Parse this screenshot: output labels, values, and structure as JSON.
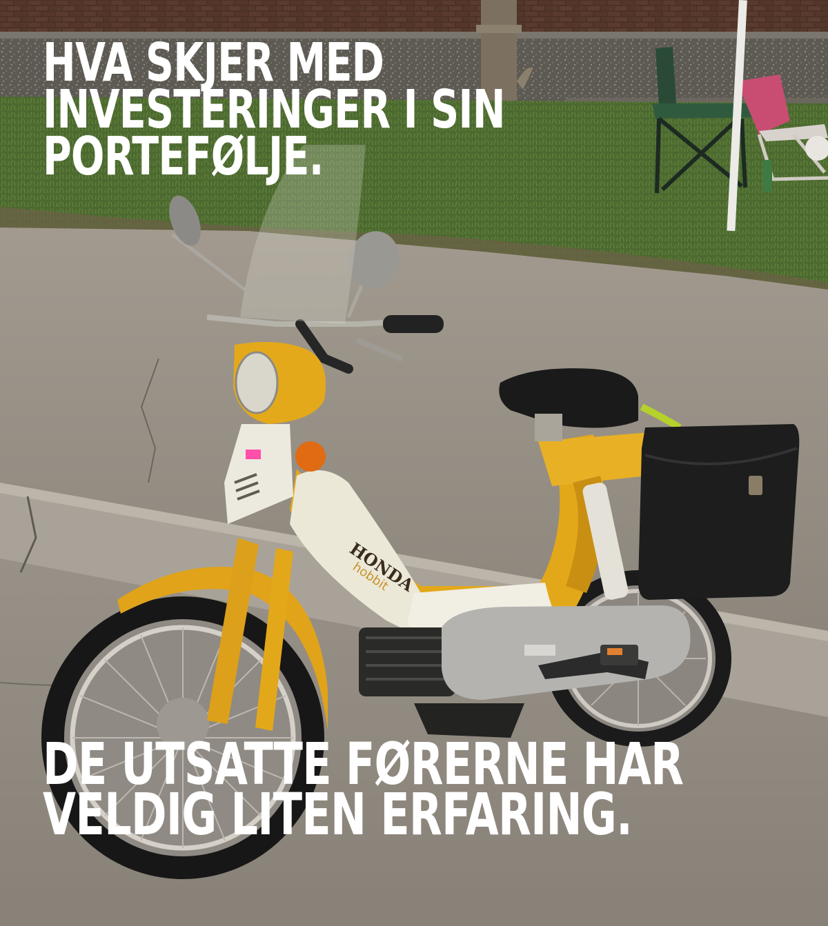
{
  "meme": {
    "top_text_lines": [
      "HVA SKJER MED",
      "INVESTERINGER I SIN",
      "PORTEFØLJE."
    ],
    "bottom_text_lines": [
      "DE UTSATTE FØRERNE HAR",
      "VELDIG LITEN ERFARING."
    ]
  },
  "photo": {
    "subject": "yellow-honda-moped",
    "brand_label": "HONDA",
    "model_label": "hobbit",
    "colors": {
      "frame_yellow": "#e3a81a",
      "body_white": "#ebe8d8",
      "pavement": "#948e84",
      "grass": "#4c6930",
      "brick": "#4a3228",
      "bag_black": "#1d1d1d"
    }
  }
}
